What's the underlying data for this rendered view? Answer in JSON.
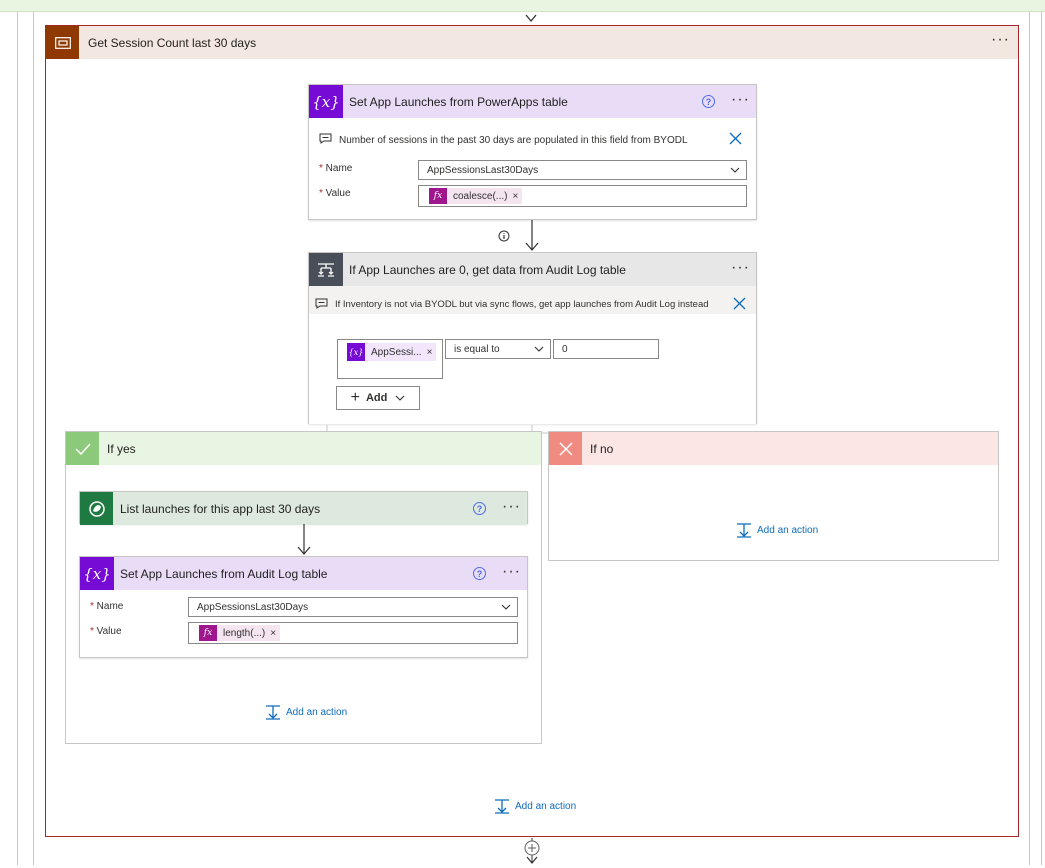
{
  "scope": {
    "title": "Get Session Count last 30 days",
    "more": "···",
    "add_action": "Add an action"
  },
  "set_powerapps": {
    "title": "Set App Launches from PowerApps table",
    "help": "?",
    "more": "···",
    "comment": "Number of sessions in the past 30 days are populated in this field from BYODL",
    "name_label": "Name",
    "name_value": "AppSessionsLast30Days",
    "value_label": "Value",
    "value_token": "coalesce(...)",
    "icon": "variable-icon"
  },
  "condition": {
    "title": "If App Launches are 0, get data from Audit Log table",
    "more": "···",
    "comment": "If Inventory is not via BYODL but via sync flows, get app launches from Audit Log instead",
    "left_token": "AppSessi...",
    "operator": "is equal to",
    "right_value": "0",
    "add_label": "Add",
    "icon": "condition-icon"
  },
  "yes_branch": {
    "title": "If yes",
    "add_action": "Add an action",
    "list_action": {
      "title": "List launches for this app last 30 days",
      "help": "?",
      "more": "···",
      "icon": "dataverse-icon"
    },
    "set_audit": {
      "title": "Set App Launches from Audit Log table",
      "help": "?",
      "more": "···",
      "name_label": "Name",
      "name_value": "AppSessionsLast30Days",
      "value_label": "Value",
      "value_token": "length(...)"
    }
  },
  "no_branch": {
    "title": "If no",
    "add_action": "Add an action"
  },
  "colors": {
    "scope_border": "#a4262c",
    "scope_icon": "#8f3900",
    "variable_header": "#e9dcf7",
    "variable_icon": "#770bd6",
    "condition_icon": "#484f58",
    "yes_header": "#e9f5e3",
    "yes_icon": "#8cc97a",
    "no_header": "#fbe6e4",
    "no_icon": "#f08b82",
    "dataverse_icon": "#1e7a40",
    "link": "#0f6cbd"
  }
}
